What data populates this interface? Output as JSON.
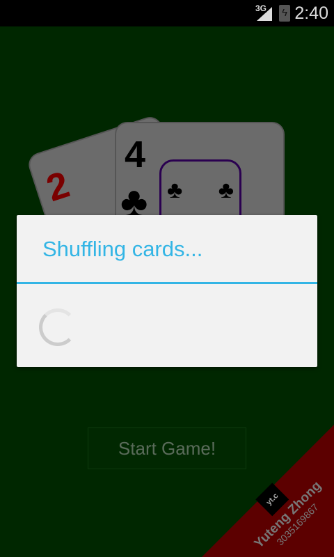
{
  "status_bar": {
    "network": "3G",
    "time": "2:40",
    "icons": [
      "signal-icon",
      "battery-charging-icon"
    ]
  },
  "cards": [
    {
      "rank": "2",
      "suit": "♦",
      "color": "#b00000"
    },
    {
      "rank": "4",
      "suit": "♣",
      "color": "#000000"
    }
  ],
  "start_button": "Start Game!",
  "brand": {
    "logo": "yt.c",
    "name": "Yuteng Zhong",
    "id": "3035169867"
  },
  "dialog": {
    "title": "Shuffling cards...",
    "accent": "#33b5e5"
  }
}
